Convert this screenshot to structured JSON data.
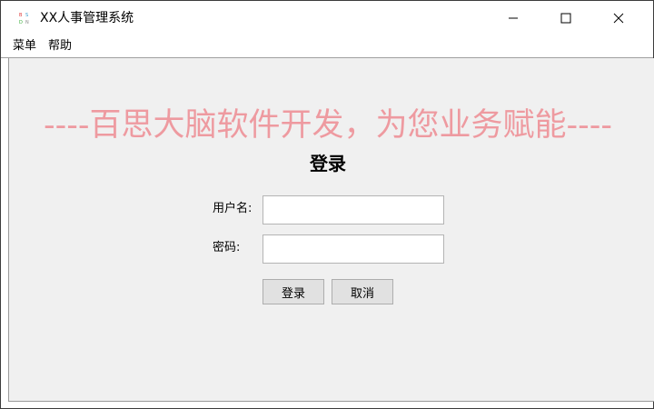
{
  "window": {
    "title": "XX人事管理系统",
    "icon": "app-logo-icon",
    "controls": [
      "minimize-icon",
      "maximize-icon",
      "close-icon"
    ]
  },
  "menubar": {
    "items": [
      {
        "label": "菜单"
      },
      {
        "label": "帮助"
      }
    ]
  },
  "banner": {
    "text": "----百思大脑软件开发，为您业务赋能----",
    "color": "#ee9aa0"
  },
  "login": {
    "title": "登录",
    "username_label": "用户名:",
    "username_value": "",
    "password_label": "密码:",
    "password_value": "",
    "login_button": "登录",
    "cancel_button": "取消"
  },
  "colors": {
    "content_bg": "#f0f0f0",
    "button_bg": "#e1e1e1"
  }
}
